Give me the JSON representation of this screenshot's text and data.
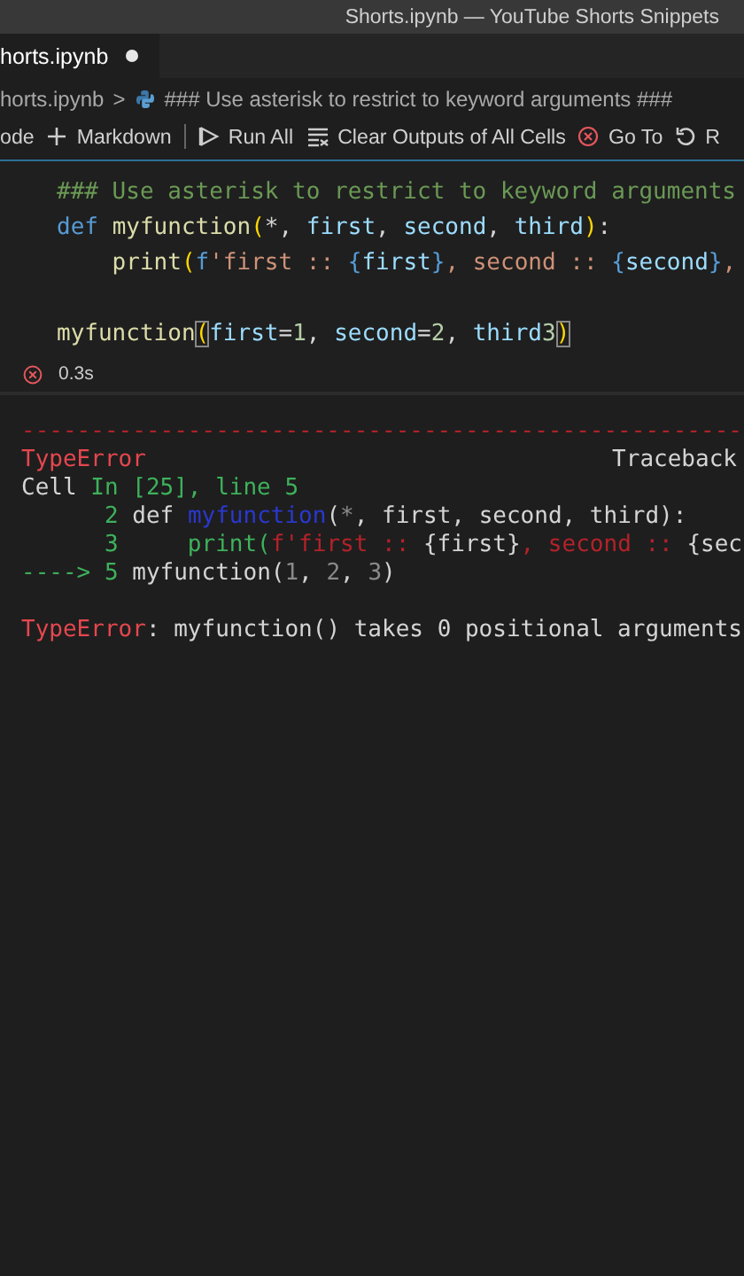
{
  "window": {
    "title": "Shorts.ipynb — YouTube Shorts Snippets"
  },
  "tab": {
    "label": "horts.ipynb",
    "modified": true
  },
  "breadcrumb": {
    "file": "horts.ipynb",
    "separator": ">",
    "cell": "### Use asterisk to restrict to keyword arguments ###"
  },
  "toolbar": [
    {
      "kind": "text",
      "label": "ode"
    },
    {
      "kind": "plus",
      "label": "Markdown"
    },
    {
      "kind": "divider"
    },
    {
      "kind": "run",
      "label": "Run All"
    },
    {
      "kind": "clear",
      "label": "Clear Outputs of All Cells"
    },
    {
      "kind": "goto",
      "label": "Go To"
    },
    {
      "kind": "restart",
      "label": "R"
    }
  ],
  "cell": {
    "lines": [
      {
        "tokens": [
          {
            "kind": "comment",
            "t": "### Use asterisk to restrict to keyword arguments"
          }
        ]
      },
      {
        "tokens": [
          {
            "kind": "keyword",
            "t": "def "
          },
          {
            "kind": "func",
            "t": "myfunction"
          },
          {
            "kind": "bracket",
            "t": "("
          },
          {
            "kind": "punct",
            "t": "*, "
          },
          {
            "kind": "param",
            "t": "first"
          },
          {
            "kind": "punct",
            "t": ", "
          },
          {
            "kind": "param",
            "t": "second"
          },
          {
            "kind": "punct",
            "t": ", "
          },
          {
            "kind": "param",
            "t": "third"
          },
          {
            "kind": "bracket",
            "t": ")"
          },
          {
            "kind": "punct",
            "t": ":"
          }
        ]
      },
      {
        "tokens": [
          {
            "kind": "func",
            "t": "    print"
          },
          {
            "kind": "bracket",
            "t": "("
          },
          {
            "kind": "keyword",
            "t": "f"
          },
          {
            "kind": "string",
            "t": "'first :: "
          },
          {
            "kind": "brace",
            "t": "{"
          },
          {
            "kind": "param",
            "t": "first"
          },
          {
            "kind": "brace",
            "t": "}"
          },
          {
            "kind": "string",
            "t": ", second :: "
          },
          {
            "kind": "brace",
            "t": "{"
          },
          {
            "kind": "param",
            "t": "second"
          },
          {
            "kind": "brace",
            "t": "}"
          },
          {
            "kind": "string",
            "t": ","
          }
        ]
      },
      {
        "blank_before": true,
        "tokens": [
          {
            "kind": "func",
            "t": "myfunction"
          },
          {
            "kind": "match",
            "t": "("
          },
          {
            "kind": "param",
            "t": "first"
          },
          {
            "kind": "punct",
            "t": "="
          },
          {
            "kind": "number",
            "t": "1"
          },
          {
            "kind": "punct",
            "t": ", "
          },
          {
            "kind": "param",
            "t": "second"
          },
          {
            "kind": "punct",
            "t": "="
          },
          {
            "kind": "number",
            "t": "2"
          },
          {
            "kind": "punct",
            "t": ", "
          },
          {
            "kind": "param",
            "t": "third"
          },
          {
            "kind": "number",
            "t": "3"
          },
          {
            "kind": "match",
            "t": ")"
          }
        ]
      }
    ],
    "status": {
      "failed": true,
      "time": "0.3s"
    }
  },
  "output": {
    "rule": "----------------------------------------------------",
    "lines": [
      {
        "tokens": [
          {
            "kind": "err",
            "t": "TypeError"
          }
        ],
        "right": "Traceback"
      },
      {
        "tokens": [
          {
            "kind": "plain",
            "t": "Cell "
          },
          {
            "kind": "green",
            "t": "In [25], line 5"
          }
        ]
      },
      {
        "tokens": [
          {
            "kind": "green",
            "t": "      2 "
          },
          {
            "kind": "plain",
            "t": "def "
          },
          {
            "kind": "dblue",
            "t": "myfunction"
          },
          {
            "kind": "plain",
            "t": "("
          },
          {
            "kind": "dim",
            "t": "*"
          },
          {
            "kind": "plain",
            "t": ", first, second, third):"
          }
        ]
      },
      {
        "tokens": [
          {
            "kind": "green",
            "t": "      3     print("
          },
          {
            "kind": "dred",
            "t": "f'first :: "
          },
          {
            "kind": "plain",
            "t": "{first}"
          },
          {
            "kind": "dred",
            "t": ", second :: "
          },
          {
            "kind": "plain",
            "t": "{sec"
          }
        ]
      },
      {
        "tokens": [
          {
            "kind": "green",
            "t": "----> 5 "
          },
          {
            "kind": "plain",
            "t": "myfunction("
          },
          {
            "kind": "dim",
            "t": "1"
          },
          {
            "kind": "plain",
            "t": ", "
          },
          {
            "kind": "dim",
            "t": "2"
          },
          {
            "kind": "plain",
            "t": ", "
          },
          {
            "kind": "dim",
            "t": "3"
          },
          {
            "kind": "plain",
            "t": ")"
          }
        ]
      },
      {
        "blank_before": true,
        "tokens": [
          {
            "kind": "err",
            "t": "TypeError"
          },
          {
            "kind": "plain",
            "t": ": myfunction() takes 0 positional arguments"
          }
        ]
      }
    ]
  }
}
